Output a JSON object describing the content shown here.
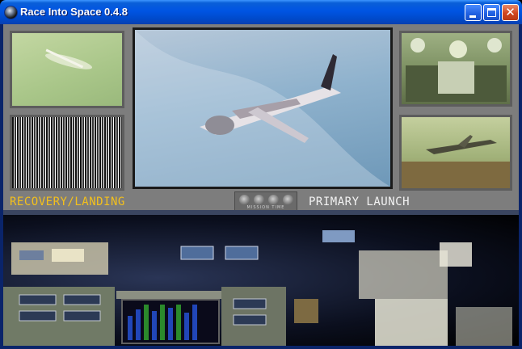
{
  "window": {
    "title": "Race Into Space 0.4.8",
    "icon": "app-sphere-icon",
    "controls": [
      "minimize",
      "maximize",
      "close"
    ]
  },
  "console": {
    "left_label": "RECOVERY/LANDING",
    "right_label": "PRIMARY LAUNCH",
    "timer_label": "MISSION TIME",
    "colors": {
      "left_label": "#f3c01c",
      "right_label": "#f2f2f2",
      "bezel": "#7d7d7d"
    }
  },
  "panels": [
    {
      "name": "recovery-video-top",
      "content": "aircraft-in-flight-view"
    },
    {
      "name": "recovery-static",
      "content": "tv-static"
    },
    {
      "name": "primary-video",
      "content": "aircraft-in-flight-view"
    },
    {
      "name": "launch-video-top",
      "content": "crew-view"
    },
    {
      "name": "launch-video-bottom",
      "content": "aircraft-on-runway-view"
    }
  ]
}
